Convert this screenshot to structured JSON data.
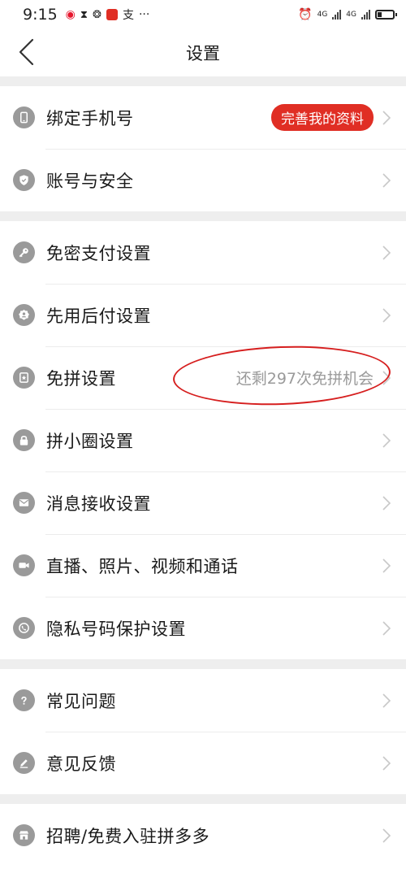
{
  "status_bar": {
    "time": "9:15",
    "left_icons": [
      "weibo-icon",
      "hourglass-icon",
      "wechat-icon",
      "pinduoduo-icon",
      "alipay-icon"
    ],
    "more": "···",
    "network_1": "4G",
    "network_2": "4G",
    "battery_level": 0.3
  },
  "header": {
    "title": "设置"
  },
  "sections": [
    {
      "items": [
        {
          "label": "绑定手机号",
          "icon": "phone-icon",
          "badge": "完善我的资料"
        },
        {
          "label": "账号与安全",
          "icon": "shield-icon"
        }
      ]
    },
    {
      "items": [
        {
          "label": "免密支付设置",
          "icon": "key-icon"
        },
        {
          "label": "先用后付设置",
          "icon": "user-badge-icon"
        },
        {
          "label": "免拼设置",
          "icon": "card-star-icon",
          "hint": "还剩297次免拼机会"
        },
        {
          "label": "拼小圈设置",
          "icon": "lock-icon"
        },
        {
          "label": "消息接收设置",
          "icon": "mail-icon"
        },
        {
          "label": "直播、照片、视频和通话",
          "icon": "video-icon"
        },
        {
          "label": "隐私号码保护设置",
          "icon": "phone-call-icon"
        }
      ]
    },
    {
      "items": [
        {
          "label": "常见问题",
          "icon": "question-icon"
        },
        {
          "label": "意见反馈",
          "icon": "edit-icon"
        }
      ]
    },
    {
      "items": [
        {
          "label": "招聘/免费入驻拼多多",
          "icon": "store-icon"
        }
      ]
    }
  ],
  "colors": {
    "accent_red": "#e02e24",
    "icon_gray": "#9a9a9a",
    "divider": "#eeeeee"
  }
}
